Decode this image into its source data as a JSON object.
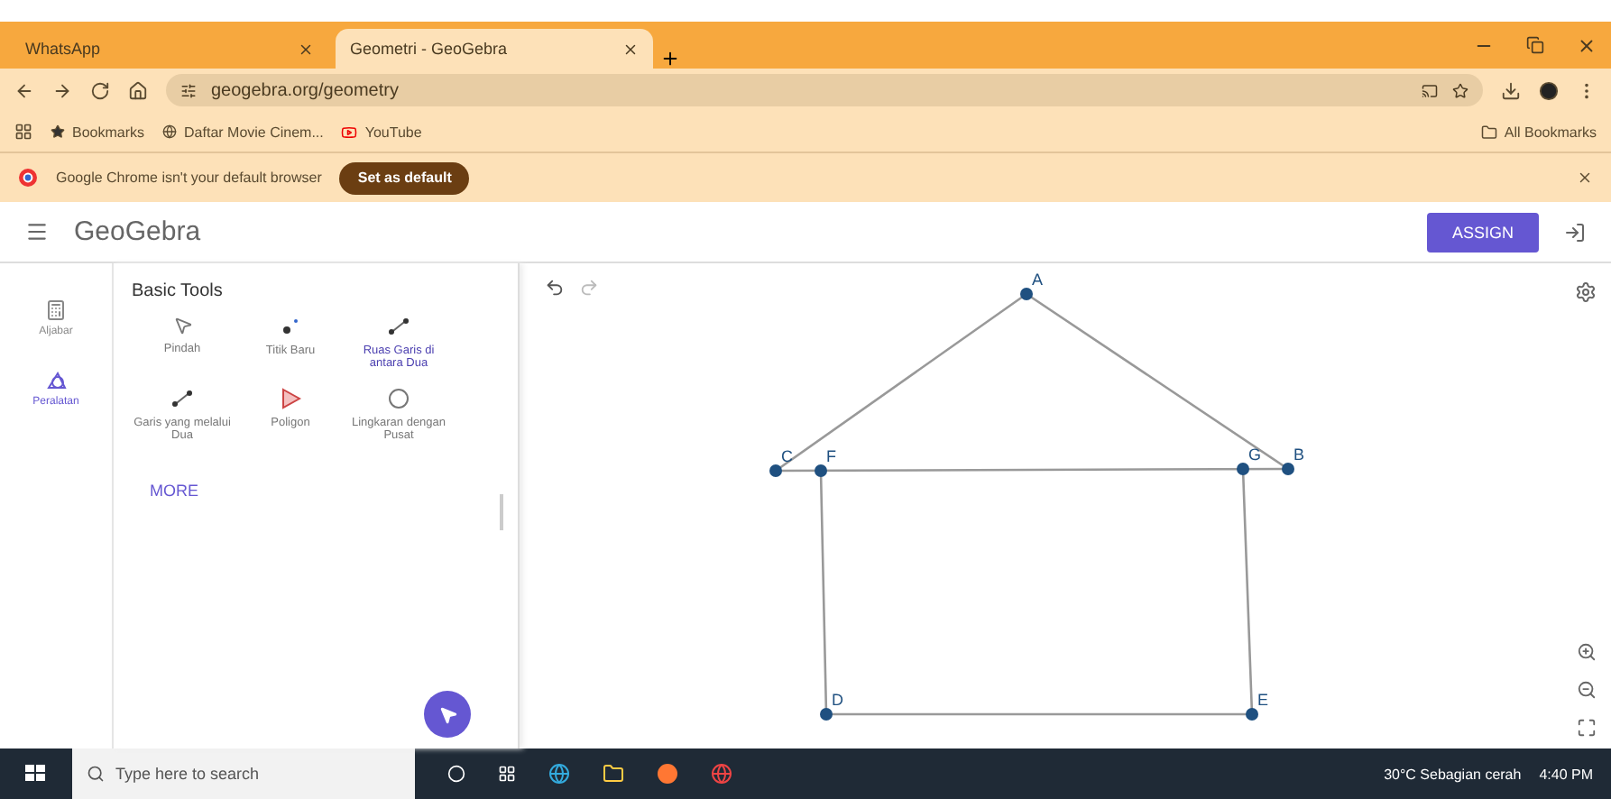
{
  "browser": {
    "tabs": [
      {
        "title": "WhatsApp",
        "selected": false
      },
      {
        "title": "Geometri - GeoGebra",
        "selected": true
      }
    ],
    "address": "geogebra.org/geometry",
    "bookmarks": [
      {
        "kind": "star",
        "label": "Bookmarks"
      },
      {
        "kind": "site",
        "label": "Daftar Movie Cinem..."
      },
      {
        "kind": "video",
        "label": "YouTube"
      }
    ],
    "all_bookmarks": "All Bookmarks",
    "infobar": {
      "message": "Google Chrome isn't your default browser",
      "button": "Set as default"
    }
  },
  "app": {
    "title": "GeoGebra",
    "assign": "ASSIGN",
    "nav": [
      {
        "label": "Aljabar",
        "selected": false
      },
      {
        "label": "Peralatan",
        "selected": true
      }
    ],
    "tools_heading": "Basic Tools",
    "tools": [
      {
        "kind": "move",
        "label": "Pindah",
        "selected": false
      },
      {
        "kind": "point",
        "label": "Titik Baru",
        "selected": false
      },
      {
        "kind": "segment",
        "label": "Ruas Garis di antara Dua",
        "selected": true
      },
      {
        "kind": "line",
        "label": "Garis yang melalui Dua",
        "selected": false
      },
      {
        "kind": "polygon",
        "label": "Poligon",
        "selected": false
      },
      {
        "kind": "circle",
        "label": "Lingkaran dengan Pusat",
        "selected": false
      }
    ],
    "more": "MORE",
    "points": [
      "A",
      "C",
      "F",
      "G",
      "B",
      "D",
      "E"
    ]
  },
  "taskbar": {
    "search_placeholder": "Type here to search",
    "weather": "30°C  Sebagian cerah",
    "time": "4:40 PM"
  }
}
